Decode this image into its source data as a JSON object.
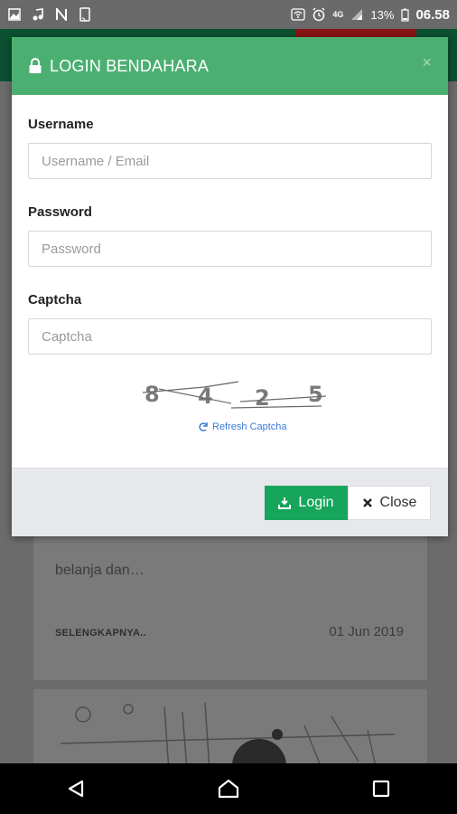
{
  "status_bar": {
    "network": "4G",
    "battery": "13%",
    "time": "06.58"
  },
  "background": {
    "excerpt": "belanja dan…",
    "read_more": "SELENGKAPNYA..",
    "date": "01 Jun 2019"
  },
  "modal": {
    "title": "LOGIN BENDAHARA",
    "close_symbol": "×",
    "username_label": "Username",
    "username_placeholder": "Username / Email",
    "password_label": "Password",
    "password_placeholder": "Password",
    "captcha_label": "Captcha",
    "captcha_placeholder": "Captcha",
    "captcha_digits": [
      "8",
      "4",
      "2",
      "5"
    ],
    "refresh_label": "Refresh Captcha",
    "login_button": "Login",
    "close_button": "Close"
  },
  "colors": {
    "header_green": "#4caf72",
    "login_green": "#17a55b",
    "link_blue": "#3a7bd5"
  }
}
